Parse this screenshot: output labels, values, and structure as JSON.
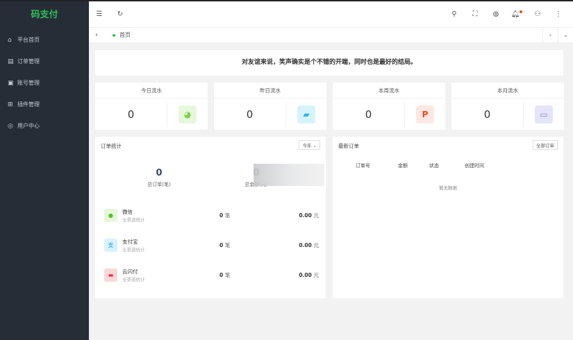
{
  "sidebar": {
    "logo": "码支付",
    "items": [
      {
        "label": "平台首页",
        "icon": "home-icon"
      },
      {
        "label": "订单管理",
        "icon": "order-icon"
      },
      {
        "label": "账号管理",
        "icon": "account-icon"
      },
      {
        "label": "插件管理",
        "icon": "plugin-icon"
      },
      {
        "label": "用户中心",
        "icon": "user-icon"
      }
    ]
  },
  "tabs": {
    "items": [
      {
        "label": "首页"
      }
    ]
  },
  "banner": {
    "text": "对友谊来说，笑声确实是个不错的开端，同时也是最好的结局。"
  },
  "cards": [
    {
      "title": "今日流水",
      "value": "0",
      "color": "#e6f7dc"
    },
    {
      "title": "昨日流水",
      "value": "0",
      "color": "#d6f3fc"
    },
    {
      "title": "本周流水",
      "value": "0",
      "color": "#fde8e4"
    },
    {
      "title": "本月流水",
      "value": "0",
      "color": "#e4e4fb"
    }
  ],
  "orders_stats": {
    "title": "订单统计",
    "range": "今年",
    "total_orders": "0",
    "total_orders_label": "总订单(笔)",
    "total_amount": "0",
    "total_amount_label": "总金额(元)",
    "channels": [
      {
        "name": "微信",
        "sub": "全渠道统计",
        "count": "0",
        "count_unit": "笔",
        "amount": "0.00",
        "amount_unit": "元"
      },
      {
        "name": "支付宝",
        "sub": "全渠道统计",
        "count": "0",
        "count_unit": "笔",
        "amount": "0.00",
        "amount_unit": "元"
      },
      {
        "name": "云闪付",
        "sub": "全渠道统计",
        "count": "0",
        "count_unit": "笔",
        "amount": "0.00",
        "amount_unit": "元"
      }
    ]
  },
  "latest_orders": {
    "title": "最新订单",
    "all_button": "全部订单",
    "columns": [
      "订单号",
      "金额",
      "状态",
      "创建时间"
    ],
    "empty": "暂无数据"
  }
}
